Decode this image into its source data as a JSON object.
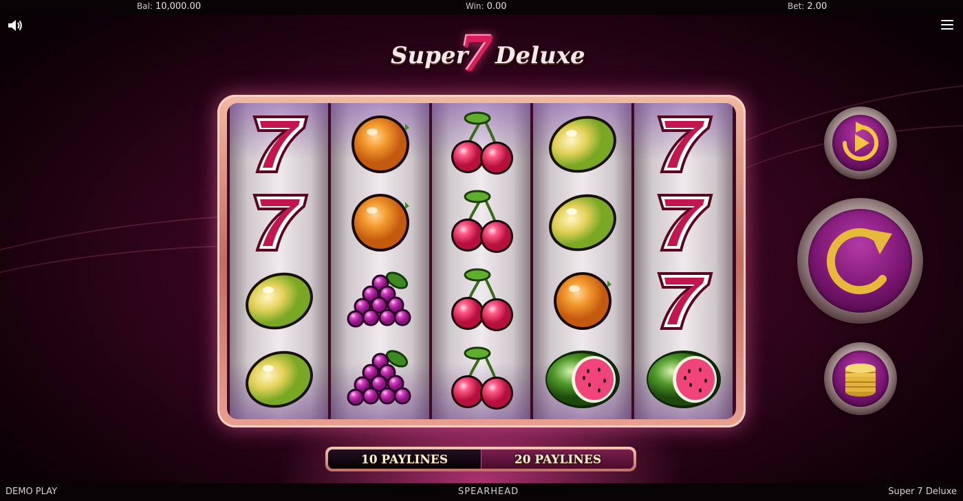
{
  "top_bar": {
    "balance_label": "Bal:",
    "balance_value": "10,000.00",
    "win_label": "Win:",
    "win_value": "0.00",
    "bet_label": "Bet:",
    "bet_value": "2.00"
  },
  "logo": {
    "word1": "Super",
    "seven": "7",
    "word2": "Deluxe"
  },
  "reels": [
    [
      "seven",
      "seven",
      "lemon",
      "lemon"
    ],
    [
      "orange",
      "orange",
      "grapes",
      "grapes"
    ],
    [
      "cherries",
      "cherries",
      "cherries",
      "cherries"
    ],
    [
      "lemon",
      "lemon",
      "orange",
      "watermelon"
    ],
    [
      "seven",
      "seven",
      "seven",
      "watermelon"
    ]
  ],
  "controls": {
    "autoplay": "autoplay-icon",
    "spin": "spin-icon",
    "bet": "coin-stack-icon"
  },
  "paylines": {
    "option_10": "10 PAYLINES",
    "option_20": "20 PAYLINES",
    "selected": "20 PAYLINES"
  },
  "bottom_bar": {
    "mode": "DEMO PLAY",
    "provider": "SPEARHEAD",
    "game_name": "Super 7 Deluxe"
  },
  "colors": {
    "background": "#2d0419",
    "accent": "#d81f5d",
    "frame": "#e8a090",
    "gold": "#f2c53d"
  }
}
